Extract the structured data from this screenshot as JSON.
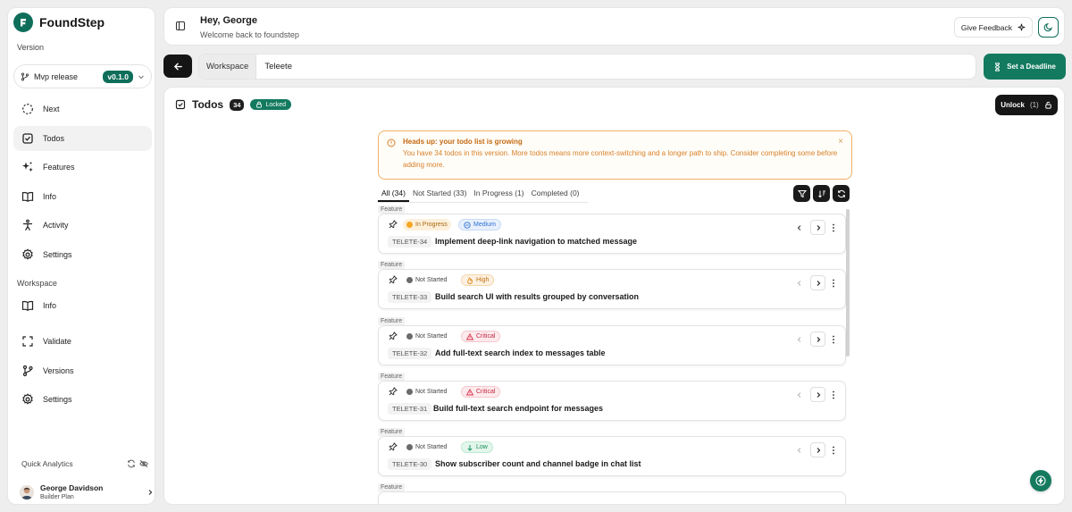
{
  "brand": {
    "name": "FoundStep"
  },
  "sidebar": {
    "version_label": "Version",
    "version_name": "Mvp release",
    "version_badge": "v0.1.0",
    "items": [
      {
        "label": "Next",
        "icon": "dashed-circle-icon"
      },
      {
        "label": "Todos",
        "icon": "check-square-icon"
      },
      {
        "label": "Features",
        "icon": "sparkles-icon"
      },
      {
        "label": "Info",
        "icon": "book-open-icon"
      },
      {
        "label": "Activity",
        "icon": "person-icon"
      },
      {
        "label": "Settings",
        "icon": "gear-icon"
      }
    ],
    "workspace_label": "Workspace",
    "workspace_items": [
      {
        "label": "Info",
        "icon": "book-open-icon"
      },
      {
        "label": "Validate",
        "icon": "scan-icon"
      },
      {
        "label": "Versions",
        "icon": "git-branch-icon"
      },
      {
        "label": "Settings",
        "icon": "gear-icon"
      }
    ],
    "quick_analytics": "Quick Analytics",
    "user": {
      "name": "George Davidson",
      "plan": "Builder Plan"
    }
  },
  "header": {
    "title": "Hey, George",
    "subtitle": "Welcome back to foundstep",
    "feedback": "Give Feedback"
  },
  "workspace_bar": {
    "label": "Workspace",
    "name": "Teleete",
    "deadline_button": "Set a Deadline"
  },
  "todos": {
    "title": "Todos",
    "count": "34",
    "locked": "Locked",
    "unlock": "Unlock",
    "unlock_count": "(1)"
  },
  "alert": {
    "title": "Heads up: your todo list is growing",
    "body": "You have 34 todos in this version. More todos means more context-switching and a longer path to ship. Consider completing some before adding more."
  },
  "tabs": [
    "All (34)",
    "Not Started (33)",
    "In Progress (1)",
    "Completed (0)"
  ],
  "todo_items": [
    {
      "type": "Feature",
      "status": "In Progress",
      "priority": "Medium",
      "id": "TELETE-34",
      "title": "Implement deep-link navigation to matched message"
    },
    {
      "type": "Feature",
      "status": "Not Started",
      "priority": "High",
      "id": "TELETE-33",
      "title": "Build search UI with results grouped by conversation"
    },
    {
      "type": "Feature",
      "status": "Not Started",
      "priority": "Critical",
      "id": "TELETE-32",
      "title": "Add full-text search index to messages table"
    },
    {
      "type": "Feature",
      "status": "Not Started",
      "priority": "Critical",
      "id": "TELETE-31",
      "title": "Build full-text search endpoint for messages"
    },
    {
      "type": "Feature",
      "status": "Not Started",
      "priority": "Low",
      "id": "TELETE-30",
      "title": "Show subscriber count and channel badge in chat list"
    },
    {
      "type": "Feature"
    }
  ],
  "colors": {
    "brand": "#0f6e5a",
    "accent_button": "#137a5f",
    "warning": "#f0b169",
    "in_progress": "#f5a623",
    "not_started": "#6b6b6b",
    "medium": "#2d6fd6",
    "high": "#e08a1b",
    "critical": "#d9344c",
    "low": "#1c9660"
  }
}
